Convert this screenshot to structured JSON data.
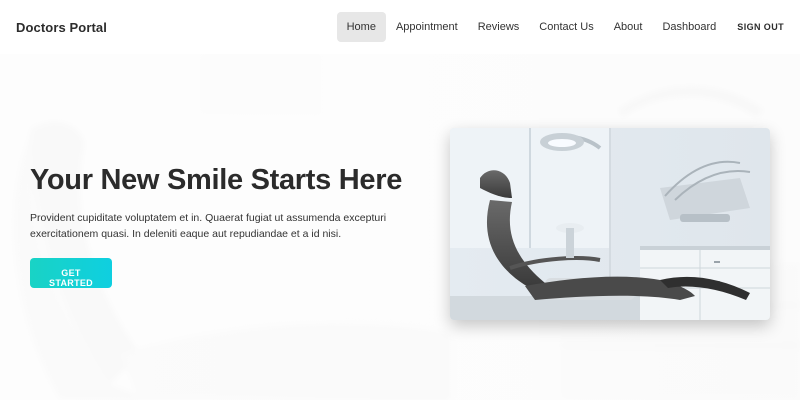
{
  "navbar": {
    "brand": "Doctors Portal",
    "links": [
      {
        "label": "Home",
        "active": true
      },
      {
        "label": "Appointment",
        "active": false
      },
      {
        "label": "Reviews",
        "active": false
      },
      {
        "label": "Contact Us",
        "active": false
      },
      {
        "label": "About",
        "active": false
      },
      {
        "label": "Dashboard",
        "active": false
      }
    ],
    "signout": "SIGN OUT"
  },
  "hero": {
    "title": "Your New Smile Starts Here",
    "description": "Provident cupiditate voluptatem et in. Quaerat fugiat ut assumenda excepturi exercitationem quasi. In deleniti eaque aut repudiandae et a id nisi.",
    "cta_label": "GET STARTED",
    "image": "dental-chair-photo",
    "background": "blurred-dental-chair-background"
  },
  "colors": {
    "accent_start": "#19d3c5",
    "accent_end": "#0fcfe0",
    "active_nav_bg": "#e7e7e7",
    "text_dark": "#2b2b2b"
  }
}
